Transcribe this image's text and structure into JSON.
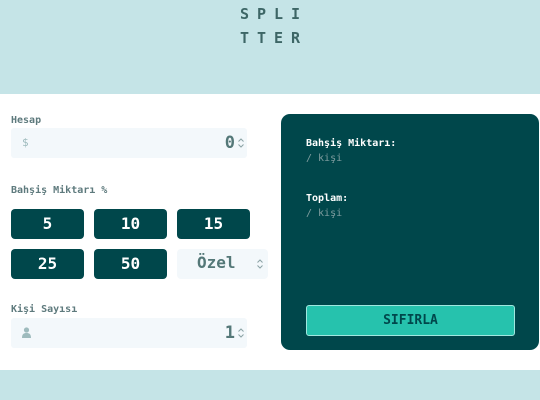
{
  "logo": {
    "line1": "SPLI",
    "line2": "TTER"
  },
  "bill": {
    "label": "Hesap",
    "currency_symbol": "$",
    "value": "0"
  },
  "tip": {
    "label": "Bahşiş Miktarı %",
    "options": [
      "5",
      "10",
      "15",
      "25",
      "50"
    ],
    "custom_placeholder": "Özel"
  },
  "people": {
    "label": "Kişi Sayısı",
    "value": "1"
  },
  "result": {
    "tip_title": "Bahşiş Miktarı:",
    "tip_sub": "/ kişi",
    "total_title": "Toplam:",
    "total_sub": "/ kişi",
    "reset_label": "SIFIRLA"
  },
  "colors": {
    "background": "#c5e4e7",
    "dark_cyan": "#00474b",
    "accent": "#26c2ad",
    "input_bg": "#f3f8fb"
  },
  "icons": {
    "bill": "dollar-icon",
    "people": "person-icon"
  }
}
